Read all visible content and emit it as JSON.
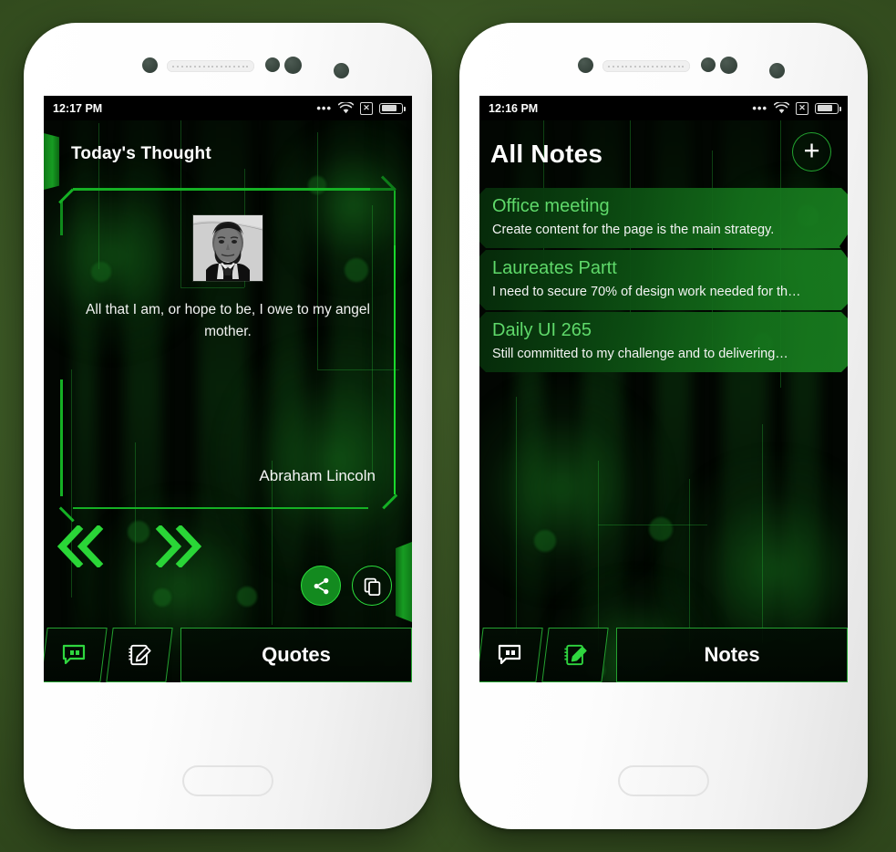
{
  "background": {
    "color_top": "#4a6a2e",
    "color_bottom": "#233616"
  },
  "accent": {
    "green": "#15b024",
    "bright_green": "#2ce03c",
    "title_green": "#5fd96a"
  },
  "phones": [
    {
      "id": "quotes-phone",
      "status_bar": {
        "time": "12:17 PM",
        "dots": "•••",
        "wifi": "wifi-icon",
        "sim": "✕",
        "battery": "battery-icon"
      },
      "header": {
        "title": "Today's Thought"
      },
      "quote": {
        "portrait_alt": "Abraham Lincoln portrait",
        "text": "All that I am, or hope to be, I owe to my angel mother.",
        "author": "Abraham Lincoln"
      },
      "controls": {
        "prev_label": "«",
        "next_label": "»",
        "share_icon": "share-icon",
        "copy_icon": "copy-icon"
      },
      "bottom_nav": {
        "quote_icon": "quote-bubble-icon",
        "notes_icon": "notepad-pencil-icon",
        "active_label": "Quotes",
        "quote_icon_state": "active",
        "notes_icon_state": "inactive"
      }
    },
    {
      "id": "notes-phone",
      "status_bar": {
        "time": "12:16 PM",
        "dots": "•••",
        "wifi": "wifi-icon",
        "sim": "✕",
        "battery": "battery-icon"
      },
      "header": {
        "title": "All Notes",
        "add_button": "+"
      },
      "notes": [
        {
          "title": "Office meeting",
          "body": "Create content for the page is the main strategy."
        },
        {
          "title": "Laureates Partt",
          "body": "I need to secure 70% of  design work needed for th…"
        },
        {
          "title": "Daily UI 265",
          "body": "Still committed to my challenge and to delivering…"
        }
      ],
      "bottom_nav": {
        "quote_icon": "quote-bubble-icon",
        "notes_icon": "notepad-pencil-icon",
        "active_label": "Notes",
        "quote_icon_state": "inactive",
        "notes_icon_state": "active"
      }
    }
  ]
}
